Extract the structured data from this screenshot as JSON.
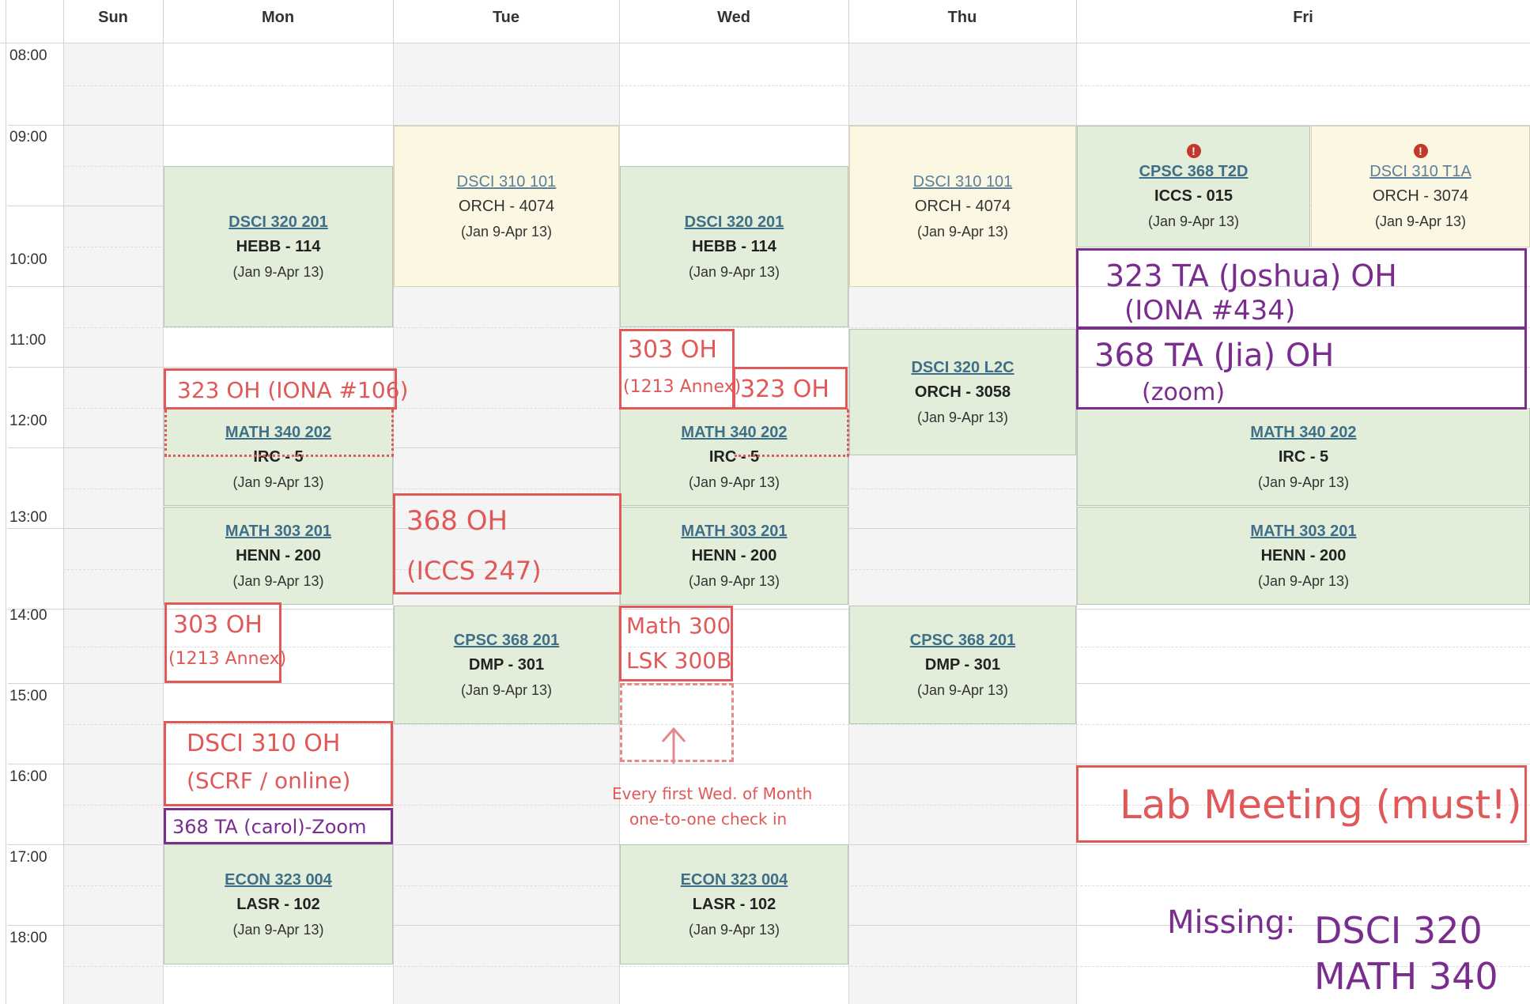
{
  "days": [
    "Sun",
    "Mon",
    "Tue",
    "Wed",
    "Thu",
    "Fri"
  ],
  "times": [
    "08:00",
    "09:00",
    "10:00",
    "11:00",
    "12:00",
    "13:00",
    "14:00",
    "15:00",
    "16:00",
    "17:00",
    "18:00"
  ],
  "events": {
    "mon_dsci320": {
      "title": "DSCI 320 201",
      "loc": "HEBB - 114",
      "dates": "(Jan 9-Apr 13)"
    },
    "mon_math340": {
      "title": "MATH 340 202",
      "loc": "IRC - 5",
      "dates": "(Jan 9-Apr 13)"
    },
    "mon_math303": {
      "title": "MATH 303 201",
      "loc": "HENN - 200",
      "dates": "(Jan 9-Apr 13)"
    },
    "mon_econ323": {
      "title": "ECON 323 004",
      "loc": "LASR - 102",
      "dates": "(Jan 9-Apr 13)"
    },
    "tue_dsci310": {
      "title": "DSCI 310 101",
      "loc": "ORCH - 4074",
      "dates": "(Jan 9-Apr 13)"
    },
    "tue_cpsc368": {
      "title": "CPSC 368 201",
      "loc": "DMP - 301",
      "dates": "(Jan 9-Apr 13)"
    },
    "wed_dsci320": {
      "title": "DSCI 320 201",
      "loc": "HEBB - 114",
      "dates": "(Jan 9-Apr 13)"
    },
    "wed_math340": {
      "title": "MATH 340 202",
      "loc": "IRC - 5",
      "dates": "(Jan 9-Apr 13)"
    },
    "wed_math303": {
      "title": "MATH 303 201",
      "loc": "HENN - 200",
      "dates": "(Jan 9-Apr 13)"
    },
    "wed_econ323": {
      "title": "ECON 323 004",
      "loc": "LASR - 102",
      "dates": "(Jan 9-Apr 13)"
    },
    "thu_dsci310": {
      "title": "DSCI 310 101",
      "loc": "ORCH - 4074",
      "dates": "(Jan 9-Apr 13)"
    },
    "thu_dsci320l": {
      "title": "DSCI 320 L2C",
      "loc": "ORCH - 3058",
      "dates": "(Jan 9-Apr 13)"
    },
    "thu_cpsc368": {
      "title": "CPSC 368 201",
      "loc": "DMP - 301",
      "dates": "(Jan 9-Apr 13)"
    },
    "fri_cpsc368": {
      "title": "CPSC 368 T2D",
      "loc": "ICCS - 015",
      "dates": "(Jan 9-Apr 13)"
    },
    "fri_dsci310": {
      "title": "DSCI 310 T1A",
      "loc": "ORCH - 3074",
      "dates": "(Jan 9-Apr 13)"
    },
    "fri_math340": {
      "title": "MATH 340 202",
      "loc": "IRC - 5",
      "dates": "(Jan 9-Apr 13)"
    },
    "fri_math303": {
      "title": "MATH 303 201",
      "loc": "HENN - 200",
      "dates": "(Jan 9-Apr 13)"
    }
  },
  "annotations": {
    "mon_323oh": "323 OH (IONA #106)",
    "mon_303oh_1": "303 OH",
    "mon_303oh_2": "(1213 Annex)",
    "mon_dsci310oh_1": "DSCI 310 OH",
    "mon_dsci310oh_2": "(SCRF / online)",
    "mon_368ta": "368 TA (carol)-Zoom",
    "tue_368oh_1": "368 OH",
    "tue_368oh_2": "(ICCS 247)",
    "wed_303oh_1": "303 OH",
    "wed_303oh_2": "(1213 Annex)",
    "wed_323oh": "323 OH",
    "wed_math300_1": "Math 300",
    "wed_math300_2": "LSK 300B",
    "wed_note_1": "Every first Wed. of Month",
    "wed_note_2": "one-to-one check in",
    "fri_323ta_1": "323 TA (Joshua) OH",
    "fri_323ta_2": "(IONA #434)",
    "fri_368ta_1": "368 TA (Jia) OH",
    "fri_368ta_2": "(zoom)",
    "fri_lab": "Lab Meeting (must!)",
    "missing_label": "Missing:",
    "missing_1": "DSCI 320",
    "missing_2": "MATH 340"
  },
  "colors": {
    "course_green": "#e2eed9",
    "course_yellow": "#fbf7e2",
    "annotation_red": "#e05858",
    "annotation_purple": "#7a2d8f",
    "link_blue": "#3f6f88"
  }
}
